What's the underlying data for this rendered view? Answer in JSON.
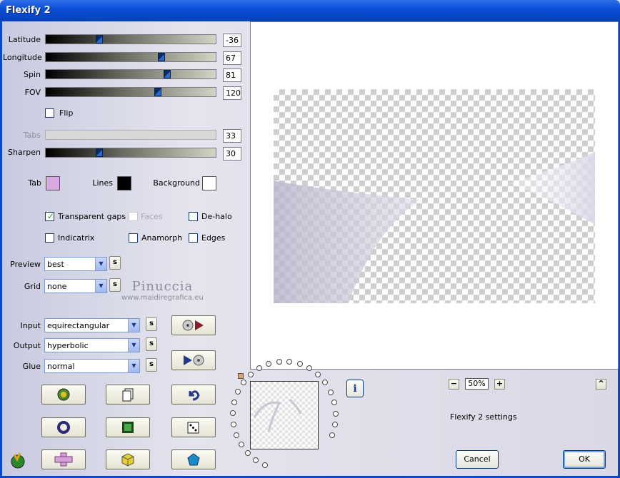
{
  "window": {
    "title": "Flexify 2"
  },
  "sliders": [
    {
      "label": "Latitude",
      "value": "-36",
      "fraction": 0.31
    },
    {
      "label": "Longitude",
      "value": "67",
      "fraction": 0.68
    },
    {
      "label": "Spin",
      "value": "81",
      "fraction": 0.71
    },
    {
      "label": "FOV",
      "value": "120",
      "fraction": 0.66
    }
  ],
  "flip_label": "Flip",
  "tabs_slider": {
    "label": "Tabs",
    "value": "33"
  },
  "sharpen_slider": {
    "label": "Sharpen",
    "value": "30",
    "fraction": 0.31
  },
  "colors": {
    "tab_label": "Tab",
    "tab_color": "#d8a8e0",
    "lines_label": "Lines",
    "lines_color": "#000000",
    "background_label": "Background",
    "background_color": "#ffffff"
  },
  "options": {
    "transparent_gaps": "Transparent gaps",
    "faces": "Faces",
    "de_halo": "De-halo",
    "indicatrix": "Indicatrix",
    "anamorph": "Anamorph",
    "edges": "Edges"
  },
  "preview_select": {
    "label": "Preview",
    "value": "best"
  },
  "grid_select": {
    "label": "Grid",
    "value": "none"
  },
  "s_label": "s",
  "watermark": {
    "line1": "Pinuccia",
    "line2": "www.maidiregrafica.eu"
  },
  "input_select": {
    "label": "Input",
    "value": "equirectangular"
  },
  "output_select": {
    "label": "Output",
    "value": "hyperbolic"
  },
  "glue_select": {
    "label": "Glue",
    "value": "normal"
  },
  "zoom": {
    "minus": "−",
    "value": "50%",
    "plus": "+",
    "up": "^"
  },
  "settings_text": "Flexify 2 settings",
  "info_icon": "i",
  "cancel_label": "Cancel",
  "ok_label": "OK"
}
